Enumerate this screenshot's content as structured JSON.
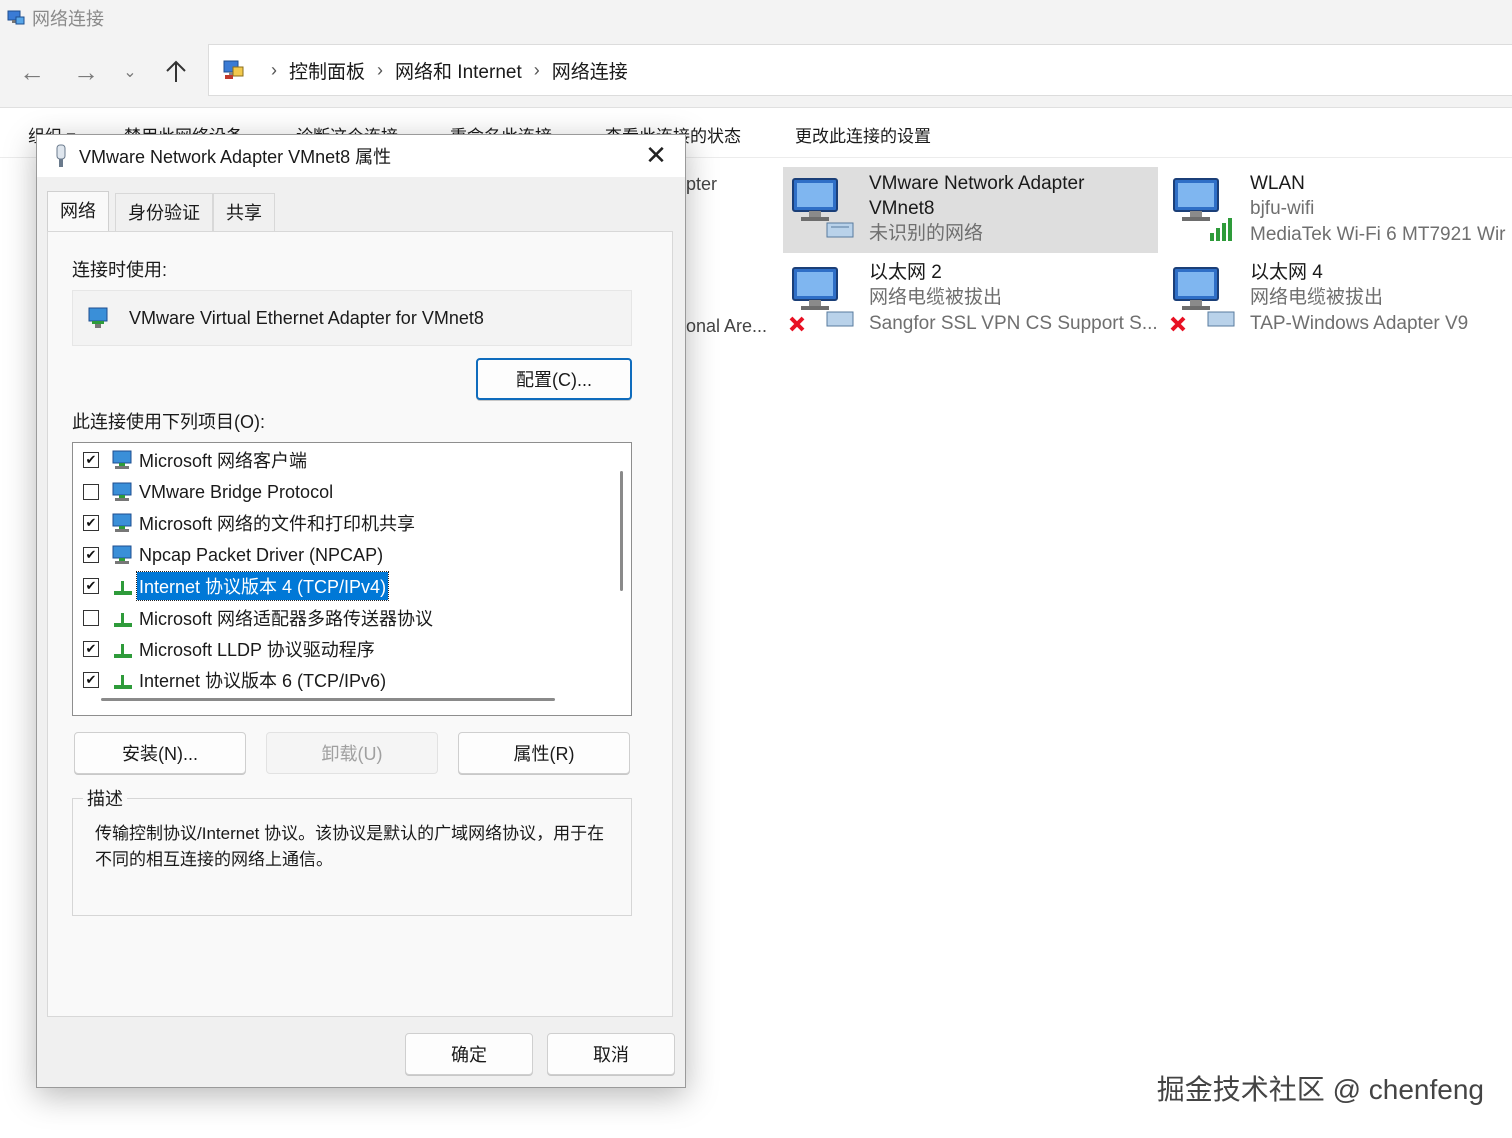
{
  "window": {
    "title": "网络连接"
  },
  "breadcrumb": [
    "控制面板",
    "网络和 Internet",
    "网络连接"
  ],
  "toolbar": {
    "organize": "组织 ▾",
    "disable": "禁用此网络设备",
    "diagnose": "诊断这个连接",
    "rename": "重命名此连接",
    "view_status": "查看此连接的状态",
    "change_settings": "更改此连接的设置"
  },
  "connections": [
    {
      "name": "VMware Network Adapter",
      "name2": "VMnet8",
      "status": "未识别的网络",
      "device": ""
    },
    {
      "name": "WLAN",
      "status": "bjfu-wifi",
      "device": "MediaTek Wi-Fi 6 MT7921 Wir"
    },
    {
      "name": "以太网 2",
      "status": "网络电缆被拔出",
      "device": "Sangfor SSL VPN CS Support S..."
    },
    {
      "name": "以太网 4",
      "status": "网络电缆被拔出",
      "device": "TAP-Windows Adapter V9"
    }
  ],
  "partial_text": {
    "p1": "pter",
    "p2": "onal Are..."
  },
  "dialog": {
    "title": "VMware Network Adapter VMnet8 属性",
    "tabs": [
      "网络",
      "身份验证",
      "共享"
    ],
    "connect_using_label": "连接时使用:",
    "adapter": "VMware Virtual Ethernet Adapter for VMnet8",
    "configure_button": "配置(C)...",
    "items_label": "此连接使用下列项目(O):",
    "items": [
      {
        "label": "Microsoft 网络客户端",
        "checked": true
      },
      {
        "label": "VMware Bridge Protocol",
        "checked": false
      },
      {
        "label": "Microsoft 网络的文件和打印机共享",
        "checked": true
      },
      {
        "label": "Npcap Packet Driver (NPCAP)",
        "checked": true
      },
      {
        "label": "Internet 协议版本 4 (TCP/IPv4)",
        "checked": true
      },
      {
        "label": "Microsoft 网络适配器多路传送器协议",
        "checked": false
      },
      {
        "label": "Microsoft LLDP 协议驱动程序",
        "checked": true
      },
      {
        "label": "Internet 协议版本 6 (TCP/IPv6)",
        "checked": true
      }
    ],
    "install_button": "安装(N)...",
    "uninstall_button": "卸载(U)",
    "properties_button": "属性(R)",
    "description_legend": "描述",
    "description": "传输控制协议/Internet 协议。该协议是默认的广域网络协议，用于在不同的相互连接的网络上通信。",
    "ok_button": "确定",
    "cancel_button": "取消"
  },
  "watermark": "掘金技术社区 @ chenfeng",
  "colors": {
    "selection": "#0078d7",
    "accent": "#0f6cbd",
    "error": "#e81123"
  }
}
